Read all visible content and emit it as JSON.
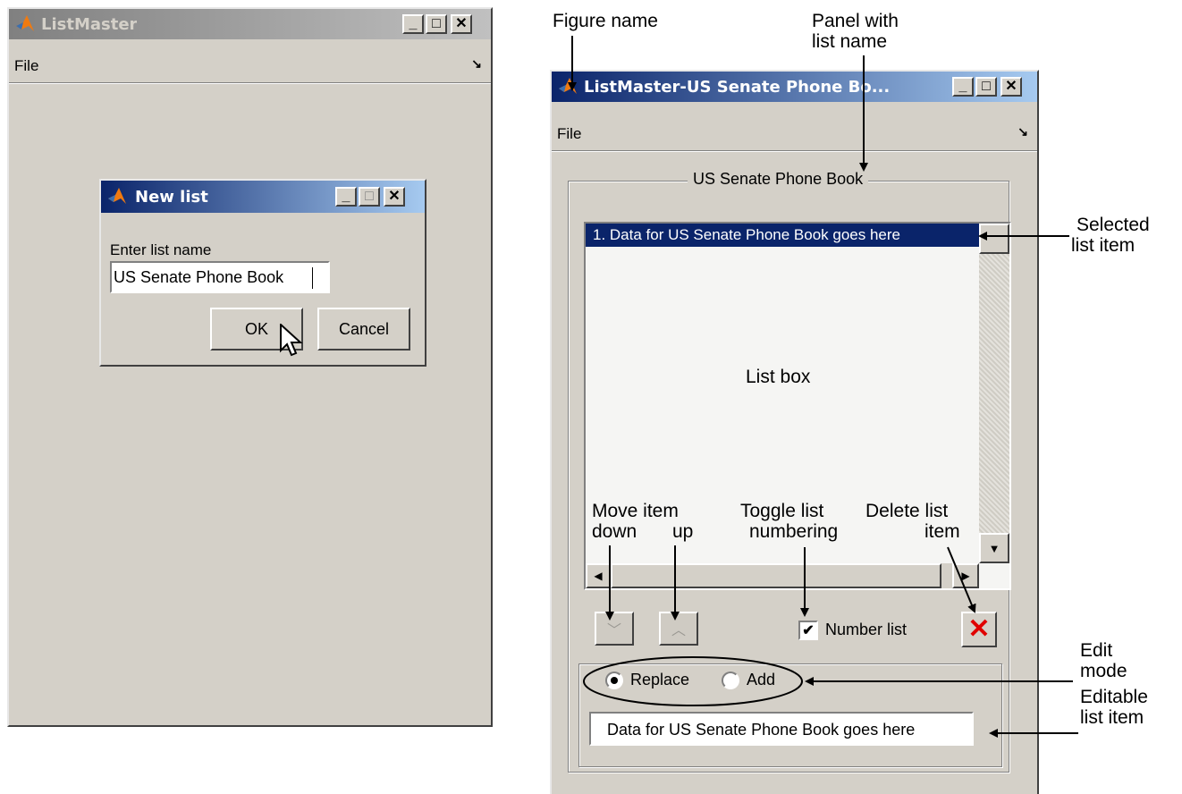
{
  "left_window": {
    "title": "ListMaster",
    "menu_file": "File",
    "dialog": {
      "title": "New list",
      "prompt": "Enter list name",
      "input_value": "US Senate Phone Book",
      "ok_label": "OK",
      "cancel_label": "Cancel"
    }
  },
  "right_window": {
    "title": "ListMaster-US Senate Phone Bo...",
    "menu_file": "File",
    "panel_title": "US Senate Phone Book",
    "list_items": [
      "1. Data for US Senate Phone Book goes here"
    ],
    "number_list_label": "Number list",
    "number_list_checked": true,
    "radio_replace": "Replace",
    "radio_add": "Add",
    "edit_value": "Data for US Senate Phone Book goes here"
  },
  "annotations": {
    "figure_name": "Figure name",
    "panel_with": "Panel with",
    "list_name": "list name",
    "selected": "Selected",
    "list_item": "list item",
    "list_box": "List box",
    "move_item": "Move item",
    "down": "down",
    "up": "up",
    "toggle_list": "Toggle list",
    "numbering": "numbering",
    "delete_list": "Delete list",
    "item": "item",
    "edit": "Edit",
    "mode": "mode",
    "editable": "Editable",
    "editable_list_item": "list item"
  },
  "colors": {
    "window_bg": "#d4d0c8",
    "title_gradient_start": "#0a246a",
    "title_gradient_end": "#a6caf0",
    "inactive_title_start": "#808080",
    "inactive_title_end": "#c0c0c0",
    "selection": "#0a246a",
    "delete_icon": "#e00000"
  }
}
